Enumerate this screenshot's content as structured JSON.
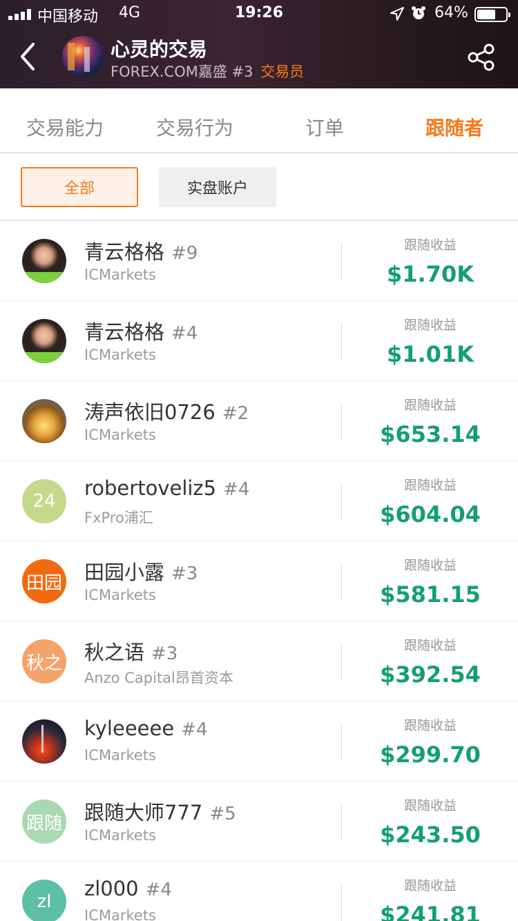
{
  "status_bar": {
    "carrier": "中国移动",
    "network": "4G",
    "time": "19:26",
    "battery": "64%"
  },
  "header": {
    "trader_name": "心灵的交易",
    "broker": "FOREX.COM嘉盛",
    "rank": "#3",
    "role": "交易员"
  },
  "tabs": [
    "交易能力",
    "交易行为",
    "订单",
    "跟随者"
  ],
  "active_tab": "跟随者",
  "filters": {
    "all": "全部",
    "live": "实盘账户"
  },
  "accent_color": "#f57a1c",
  "profit_color": "#14a06e",
  "followers": [
    {
      "name": "青云格格",
      "rank": "#9",
      "broker": "ICMarkets",
      "profit_label": "跟随收益",
      "profit": "$1.70K",
      "avatar_text": "",
      "avatar_style": "photo-woman"
    },
    {
      "name": "青云格格",
      "rank": "#4",
      "broker": "ICMarkets",
      "profit_label": "跟随收益",
      "profit": "$1.01K",
      "avatar_text": "",
      "avatar_style": "photo-woman"
    },
    {
      "name": "涛声依旧0726",
      "rank": "#2",
      "broker": "ICMarkets",
      "profit_label": "跟随收益",
      "profit": "$653.14",
      "avatar_text": "",
      "avatar_style": "photo-forest"
    },
    {
      "name": "robertoveliz5",
      "rank": "#4",
      "broker": "FxPro浦汇",
      "profit_label": "跟随收益",
      "profit": "$604.04",
      "avatar_text": "24",
      "avatar_color": "#c4d98a"
    },
    {
      "name": "田园小露",
      "rank": "#3",
      "broker": "ICMarkets",
      "profit_label": "跟随收益",
      "profit": "$581.15",
      "avatar_text": "田园",
      "avatar_color": "#f26a10"
    },
    {
      "name": "秋之语",
      "rank": "#3",
      "broker": "Anzo Capital昂首资本",
      "profit_label": "跟随收益",
      "profit": "$392.54",
      "avatar_text": "秋之",
      "avatar_color": "#f4a46a"
    },
    {
      "name": "kyleeeee",
      "rank": "#4",
      "broker": "ICMarkets",
      "profit_label": "跟随收益",
      "profit": "$299.70",
      "avatar_text": "",
      "avatar_style": "photo-city"
    },
    {
      "name": "跟随大师777",
      "rank": "#5",
      "broker": "ICMarkets",
      "profit_label": "跟随收益",
      "profit": "$243.50",
      "avatar_text": "跟随",
      "avatar_color": "#a9d9b0"
    },
    {
      "name": "zl000",
      "rank": "#4",
      "broker": "ICMarkets",
      "profit_label": "跟随收益",
      "profit": "$241.81",
      "avatar_text": "zl",
      "avatar_color": "#5dbfa3"
    }
  ]
}
